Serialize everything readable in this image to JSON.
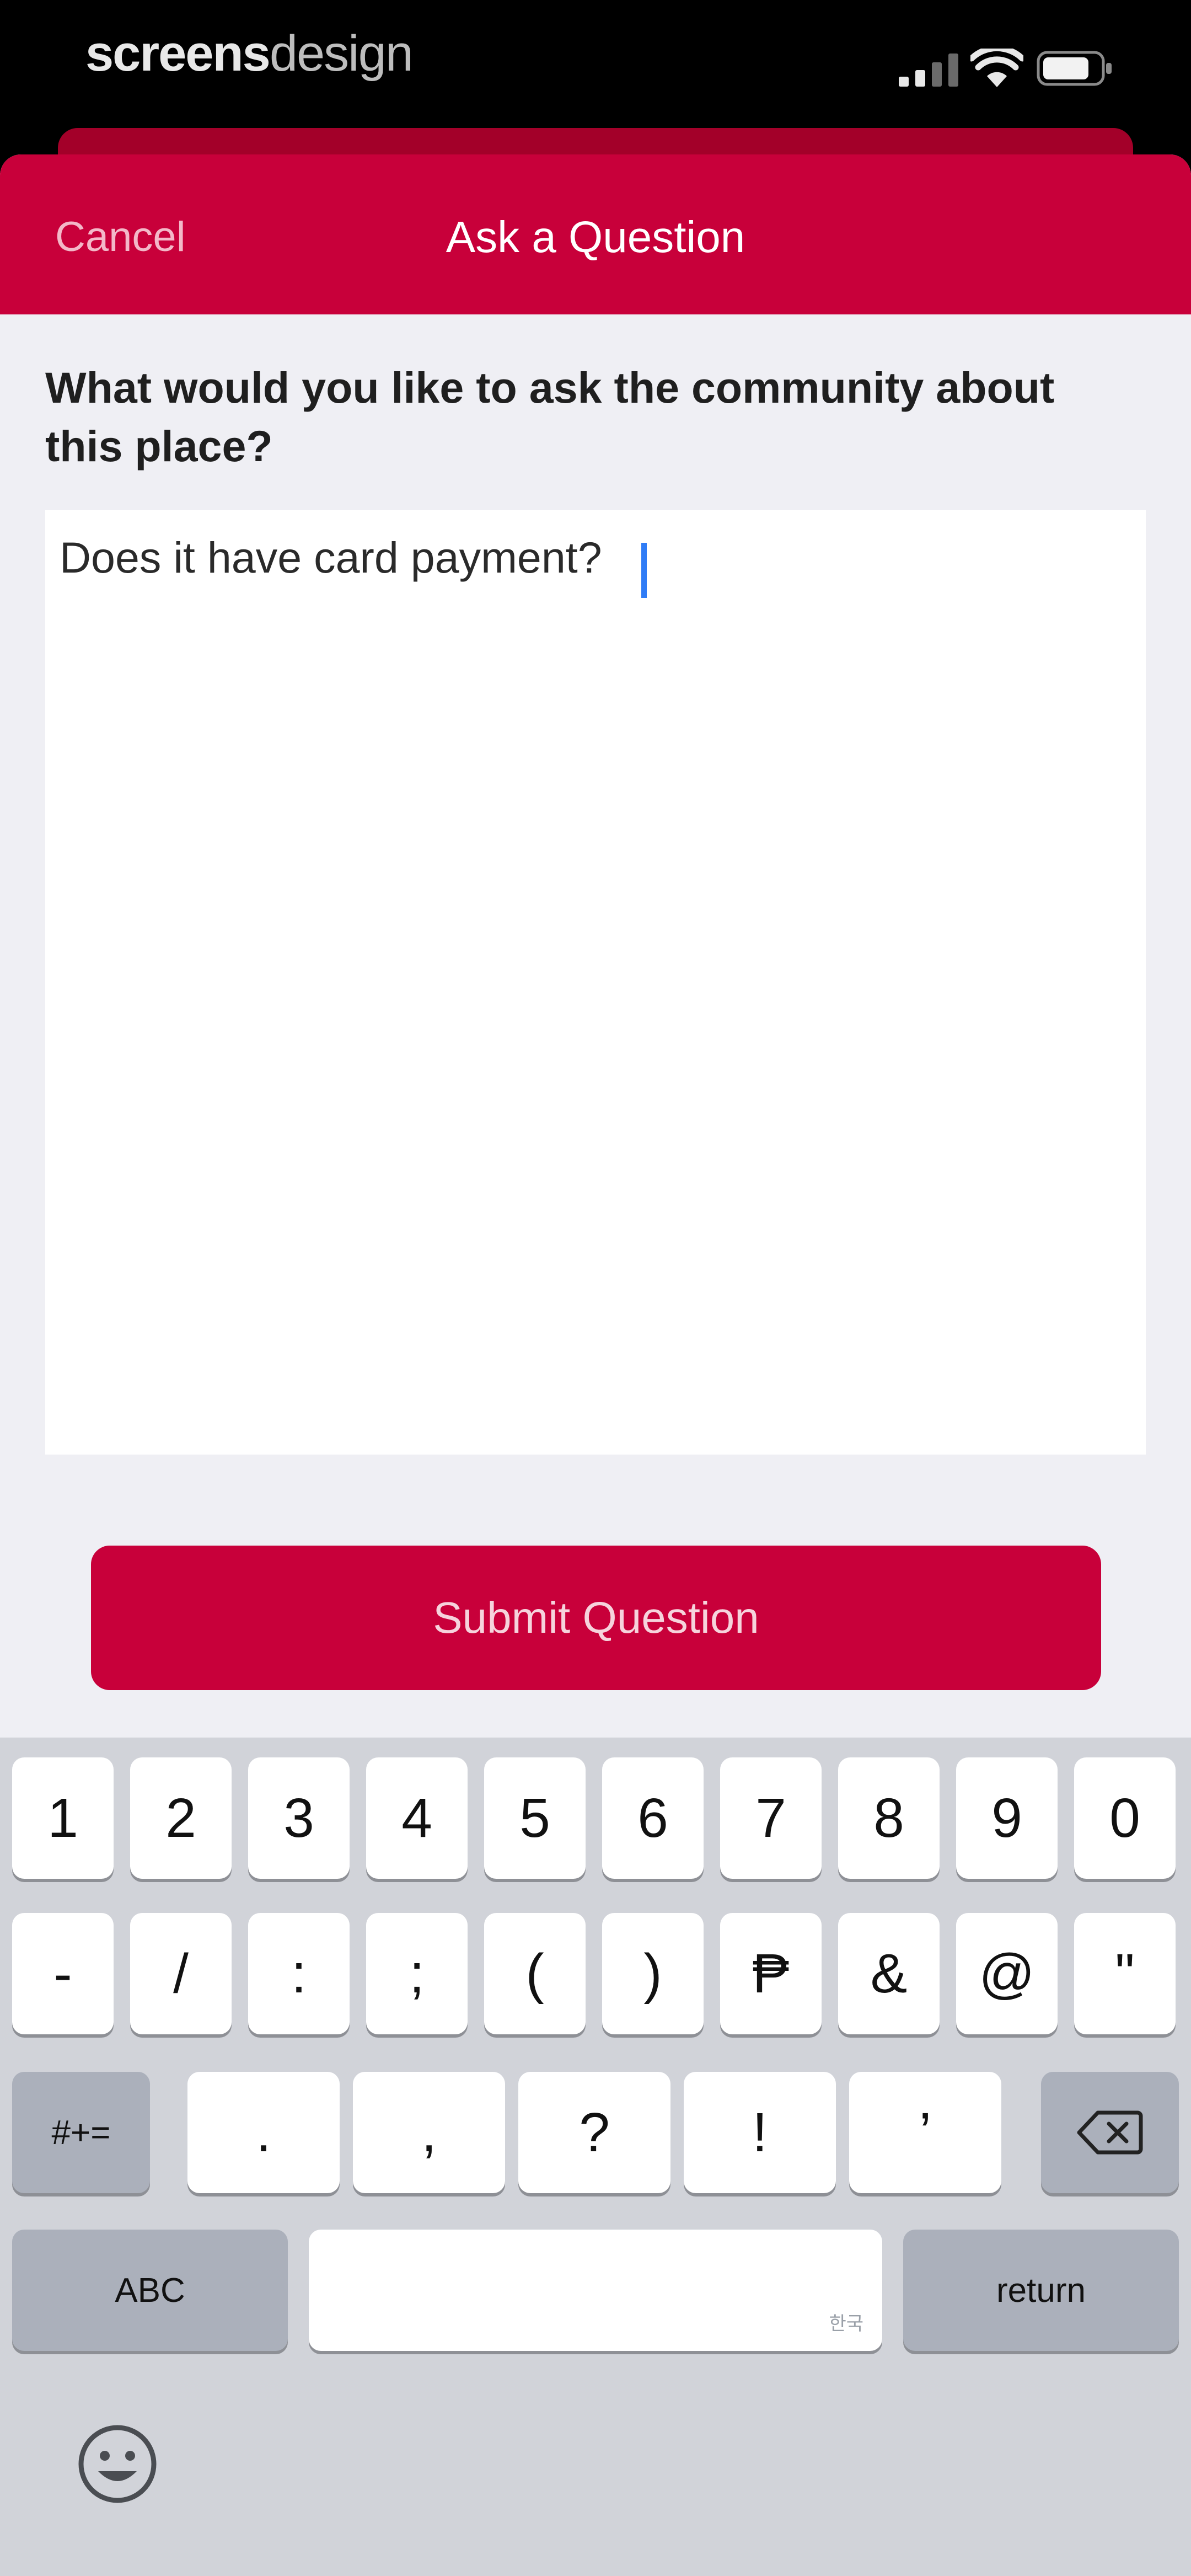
{
  "status_bar": {
    "carrier_bold": "screens",
    "carrier_light": "design",
    "icons": [
      "signal-icon",
      "wifi-icon",
      "battery-icon"
    ]
  },
  "nav": {
    "cancel_label": "Cancel",
    "title": "Ask a Question"
  },
  "form": {
    "prompt": "What would you like to ask the community about this place?",
    "question_value": "Does it have card payment?",
    "submit_label": "Submit Question"
  },
  "keyboard": {
    "row1": [
      "1",
      "2",
      "3",
      "4",
      "5",
      "6",
      "7",
      "8",
      "9",
      "0"
    ],
    "row2": [
      "-",
      "/",
      ":",
      ";",
      "(",
      ")",
      "₱",
      "&",
      "@",
      "\""
    ],
    "row3_toggle": "#+=",
    "row3": [
      ".",
      ",",
      "?",
      "!",
      "’"
    ],
    "abc_label": "ABC",
    "space_hint": "한국",
    "return_label": "return",
    "icons": [
      "backspace-icon",
      "emoji-icon"
    ]
  },
  "colors": {
    "brand": "#c8003a",
    "brand_dark": "#a30029",
    "sheet_bg": "#efeff4",
    "keyboard_bg": "#d1d3d9",
    "caret": "#2f7cf6"
  }
}
